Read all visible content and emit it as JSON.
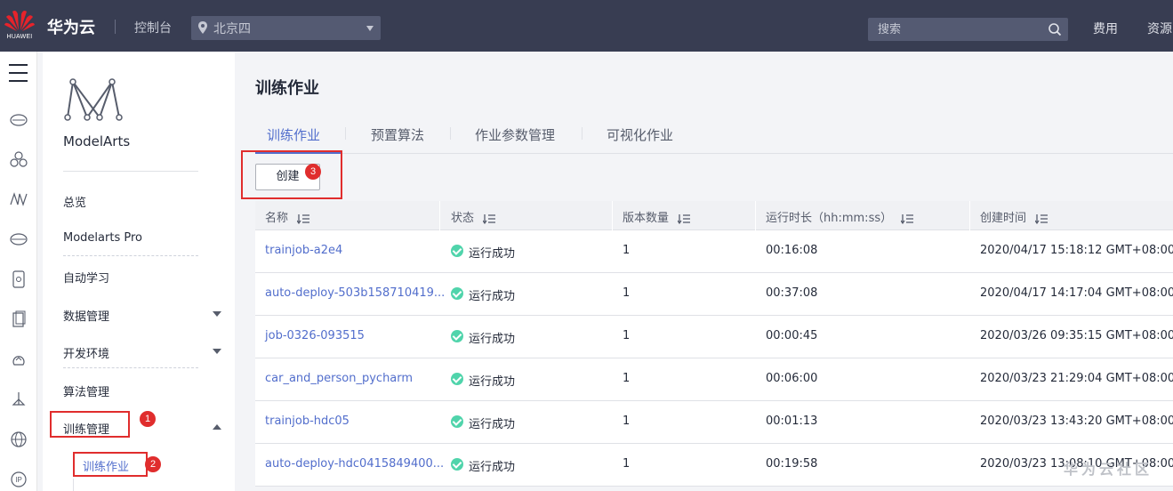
{
  "header": {
    "logo_text": "HUAWEI",
    "brand": "华为云",
    "console": "控制台",
    "region": "北京四",
    "search_placeholder": "搜索",
    "fee": "费用",
    "resources": "资源"
  },
  "sidebar": {
    "product": "ModelArts",
    "items": [
      "总览",
      "Modelarts Pro",
      "自动学习",
      "数据管理",
      "开发环境",
      "算法管理",
      "训练管理"
    ],
    "subitem": "训练作业"
  },
  "main": {
    "title": "训练作业",
    "tabs": [
      "训练作业",
      "预置算法",
      "作业参数管理",
      "可视化作业"
    ],
    "create_label": "创建",
    "columns": [
      "名称",
      "状态",
      "版本数量",
      "运行时长（hh:mm:ss）",
      "创建时间"
    ],
    "rows": [
      {
        "name": "trainjob-a2e4",
        "status": "运行成功",
        "versions": "1",
        "duration": "00:16:08",
        "created": "2020/04/17 15:18:12 GMT+08:00"
      },
      {
        "name": "auto-deploy-503b158710419...",
        "status": "运行成功",
        "versions": "1",
        "duration": "00:37:08",
        "created": "2020/04/17 14:17:04 GMT+08:00"
      },
      {
        "name": "job-0326-093515",
        "status": "运行成功",
        "versions": "1",
        "duration": "00:00:45",
        "created": "2020/03/26 09:35:15 GMT+08:00"
      },
      {
        "name": "car_and_person_pycharm",
        "status": "运行成功",
        "versions": "1",
        "duration": "00:06:00",
        "created": "2020/03/23 21:29:04 GMT+08:00"
      },
      {
        "name": "trainjob-hdc05",
        "status": "运行成功",
        "versions": "1",
        "duration": "00:01:13",
        "created": "2020/03/23 13:43:20 GMT+08:00"
      },
      {
        "name": "auto-deploy-hdc0415849400...",
        "status": "运行成功",
        "versions": "1",
        "duration": "00:19:58",
        "created": "2020/03/23 13:08:10 GMT+08:00"
      }
    ]
  },
  "annotations": [
    "1",
    "2",
    "3"
  ],
  "watermark": "华为云社区",
  "colors": {
    "topbar": "#383d52",
    "accent": "#526ecc",
    "success": "#50d4ab",
    "highlight": "#e02d2d"
  }
}
